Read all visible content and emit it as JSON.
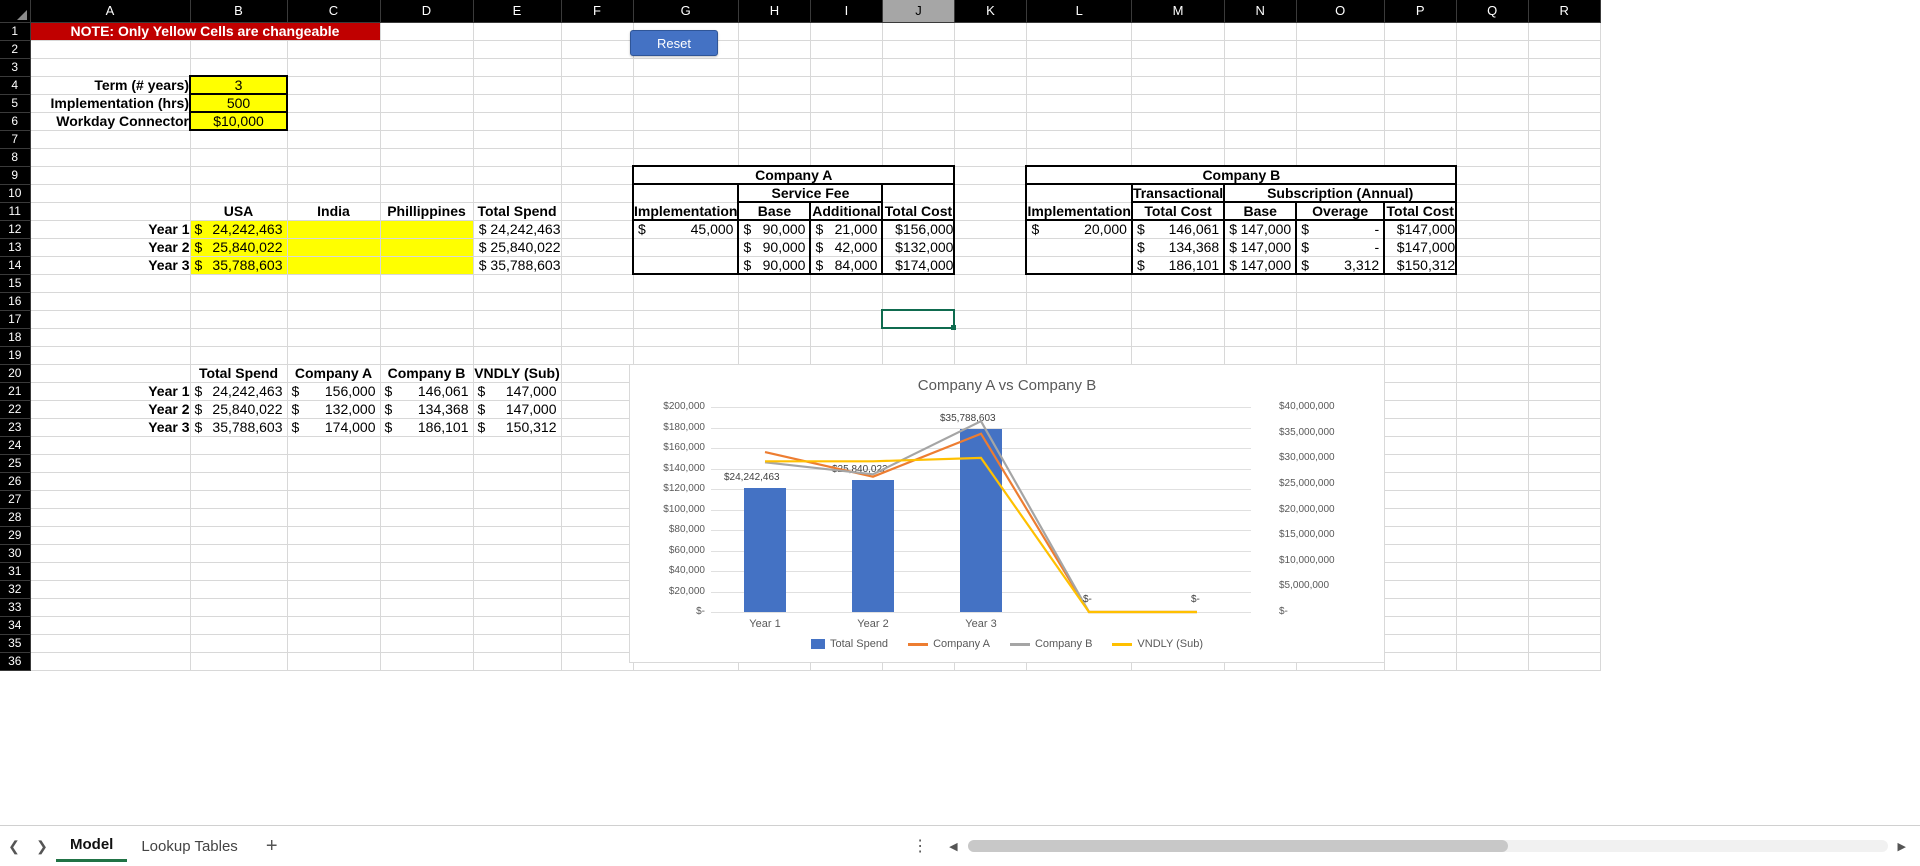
{
  "app": {
    "note_banner": "NOTE:  Only Yellow Cells are changeable",
    "reset_label": "Reset",
    "selected_column": "J",
    "columns": [
      "A",
      "B",
      "C",
      "D",
      "E",
      "F",
      "G",
      "H",
      "I",
      "J",
      "K",
      "L",
      "M",
      "N",
      "O",
      "P",
      "Q",
      "R"
    ],
    "rows": [
      1,
      2,
      3,
      4,
      5,
      6,
      7,
      8,
      9,
      10,
      11,
      12,
      13,
      14,
      15,
      16,
      17,
      18,
      19,
      20,
      21,
      22,
      23,
      24,
      25,
      26,
      27,
      28,
      29,
      30,
      31,
      32,
      33,
      34,
      35,
      36
    ]
  },
  "inputs": {
    "term_label": "Term (# years)",
    "term_value": "3",
    "implementation_label": "Implementation (hrs)",
    "implementation_value": "500",
    "connector_label": "Workday Connector",
    "connector_value": "$10,000"
  },
  "spend_table": {
    "headers": [
      "USA",
      "India",
      "Phillippines",
      "Total Spend"
    ],
    "rows": [
      {
        "year": "Year 1",
        "usa_dollar": "$",
        "usa": "24,242,463",
        "india": "",
        "phillippines": "",
        "total": "$ 24,242,463"
      },
      {
        "year": "Year 2",
        "usa_dollar": "$",
        "usa": "25,840,022",
        "india": "",
        "phillippines": "",
        "total": "$ 25,840,022"
      },
      {
        "year": "Year 3",
        "usa_dollar": "$",
        "usa": "35,788,603",
        "india": "",
        "phillippines": "",
        "total": "$ 35,788,603"
      }
    ]
  },
  "company_a": {
    "title": "Company A",
    "group_label": "Service Fee",
    "headers": [
      "Implementation",
      "Base",
      "Additional",
      "Total Cost"
    ],
    "rows": [
      {
        "impl_dollar": "$",
        "impl": "45,000",
        "base_dollar": "$",
        "base": "90,000",
        "add_dollar": "$",
        "additional": "21,000",
        "total": "$156,000"
      },
      {
        "impl_dollar": "",
        "impl": "",
        "base_dollar": "$",
        "base": "90,000",
        "add_dollar": "$",
        "additional": "42,000",
        "total": "$132,000"
      },
      {
        "impl_dollar": "",
        "impl": "",
        "base_dollar": "$",
        "base": "90,000",
        "add_dollar": "$",
        "additional": "84,000",
        "total": "$174,000"
      }
    ]
  },
  "company_b": {
    "title": "Company B",
    "group_transactional": "Transactional",
    "group_subscription": "Subscription (Annual)",
    "headers": [
      "Implementation",
      "Total Cost",
      "Base",
      "Overage",
      "Total Cost"
    ],
    "rows": [
      {
        "impl_dollar": "$",
        "impl": "20,000",
        "tc_dollar": "$",
        "trans_total": "146,061",
        "base_dollar": "$",
        "base": "147,000",
        "ov_dollar": "$",
        "overage": "-",
        "total": "$147,000"
      },
      {
        "impl_dollar": "",
        "impl": "",
        "tc_dollar": "$",
        "trans_total": "134,368",
        "base_dollar": "$",
        "base": "147,000",
        "ov_dollar": "$",
        "overage": "-",
        "total": "$147,000"
      },
      {
        "impl_dollar": "",
        "impl": "",
        "tc_dollar": "$",
        "trans_total": "186,101",
        "base_dollar": "$",
        "base": "147,000",
        "ov_dollar": "$",
        "overage": "3,312",
        "total": "$150,312"
      }
    ]
  },
  "summary_table": {
    "headers": [
      "Total Spend",
      "Company A",
      "Company B",
      "VNDLY (Sub)"
    ],
    "rows": [
      {
        "year": "Year 1",
        "d1": "$",
        "total_spend": "24,242,463",
        "d2": "$",
        "company_a": "156,000",
        "d3": "$",
        "company_b": "146,061",
        "d4": "$",
        "vndly": "147,000"
      },
      {
        "year": "Year 2",
        "d1": "$",
        "total_spend": "25,840,022",
        "d2": "$",
        "company_a": "132,000",
        "d3": "$",
        "company_b": "134,368",
        "d4": "$",
        "vndly": "147,000"
      },
      {
        "year": "Year 3",
        "d1": "$",
        "total_spend": "35,788,603",
        "d2": "$",
        "company_a": "174,000",
        "d3": "$",
        "company_b": "186,101",
        "d4": "$",
        "vndly": "150,312"
      }
    ]
  },
  "chart_data": {
    "type": "bar",
    "title": "Company A vs Company B",
    "categories": [
      "Year 1",
      "Year 2",
      "Year 3"
    ],
    "xlabel": "",
    "ylabel": "",
    "grid": true,
    "legend_position": "bottom",
    "primary_axis": {
      "ticks": [
        "$-",
        "$20,000",
        "$40,000",
        "$60,000",
        "$80,000",
        "$100,000",
        "$120,000",
        "$140,000",
        "$160,000",
        "$180,000",
        "$200,000"
      ],
      "min": 0,
      "max": 200000
    },
    "secondary_axis": {
      "ticks": [
        "$-",
        "$5,000,000",
        "$10,000,000",
        "$15,000,000",
        "$20,000,000",
        "$25,000,000",
        "$30,000,000",
        "$35,000,000",
        "$40,000,000"
      ],
      "min": 0,
      "max": 40000000
    },
    "series": [
      {
        "name": "Total Spend",
        "type": "bar",
        "axis": "secondary",
        "color": "#4472C4",
        "values": [
          24242463,
          25840022,
          35788603
        ],
        "data_labels": [
          "$24,242,463",
          "$25,840,022",
          "$35,788,603"
        ]
      },
      {
        "name": "Company A",
        "type": "line",
        "axis": "primary",
        "color": "#ED7D31",
        "values": [
          156000,
          132000,
          174000
        ],
        "trailing_labels": [
          "$-",
          "$-"
        ]
      },
      {
        "name": "Company B",
        "type": "line",
        "axis": "primary",
        "color": "#A5A5A5",
        "values": [
          146061,
          134368,
          186101
        ]
      },
      {
        "name": "VNDLY (Sub)",
        "type": "line",
        "axis": "primary",
        "color": "#FFC000",
        "values": [
          147000,
          147000,
          150312
        ]
      }
    ],
    "annotations": [
      "$-",
      "$-"
    ]
  },
  "sheet_tabs": {
    "tabs": [
      {
        "label": "Model",
        "active": true
      },
      {
        "label": "Lookup Tables",
        "active": false
      }
    ],
    "add_label": "+",
    "prev_icon": "chevron-left-icon",
    "next_icon": "chevron-right-icon",
    "more_icon": "vertical-ellipsis-icon"
  }
}
